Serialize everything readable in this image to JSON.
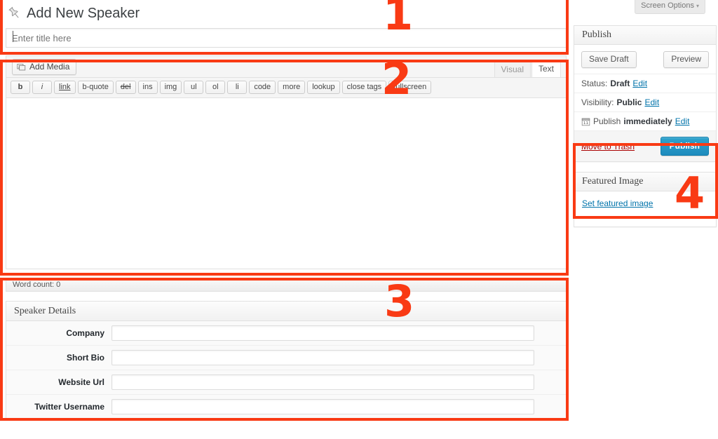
{
  "screen_meta": {
    "screen_options_label": "Screen Options",
    "caret": "▾"
  },
  "title_section": {
    "icon": "pushpin-icon",
    "heading": "Add New Speaker",
    "title_input_value": "",
    "title_input_placeholder": "Enter title here"
  },
  "editor": {
    "add_media_label": "Add Media",
    "tabs": [
      {
        "label": "Visual",
        "active": false
      },
      {
        "label": "Text",
        "active": true
      }
    ],
    "quicktags": [
      "b",
      "i",
      "link",
      "b-quote",
      "del",
      "ins",
      "img",
      "ul",
      "ol",
      "li",
      "code",
      "more",
      "lookup",
      "close tags",
      "fullscreen"
    ],
    "content": "",
    "word_count_label": "Word count: 0"
  },
  "speaker_details": {
    "heading": "Speaker Details",
    "fields": [
      {
        "label": "Company",
        "value": ""
      },
      {
        "label": "Short Bio",
        "value": ""
      },
      {
        "label": "Website Url",
        "value": ""
      },
      {
        "label": "Twitter Username",
        "value": ""
      }
    ]
  },
  "publish_box": {
    "heading": "Publish",
    "save_draft_label": "Save Draft",
    "preview_label": "Preview",
    "status_label": "Status:",
    "status_value": "Draft",
    "status_edit": "Edit",
    "visibility_label": "Visibility:",
    "visibility_value": "Public",
    "visibility_edit": "Edit",
    "schedule_icon": "calendar-icon",
    "schedule_label": "Publish",
    "schedule_value": "immediately",
    "schedule_edit": "Edit",
    "trash_label": "Move to Trash",
    "publish_label": "Publish"
  },
  "featured_image_box": {
    "heading": "Featured Image",
    "set_link_label": "Set featured image"
  },
  "annotations": {
    "color": "#f93a14",
    "numbers": [
      {
        "id": "1",
        "label": "1",
        "target": "title-section"
      },
      {
        "id": "2",
        "label": "2",
        "target": "editor-section"
      },
      {
        "id": "3",
        "label": "3",
        "target": "speaker-details-section"
      },
      {
        "id": "4",
        "label": "4",
        "target": "featured-image-section"
      }
    ]
  }
}
